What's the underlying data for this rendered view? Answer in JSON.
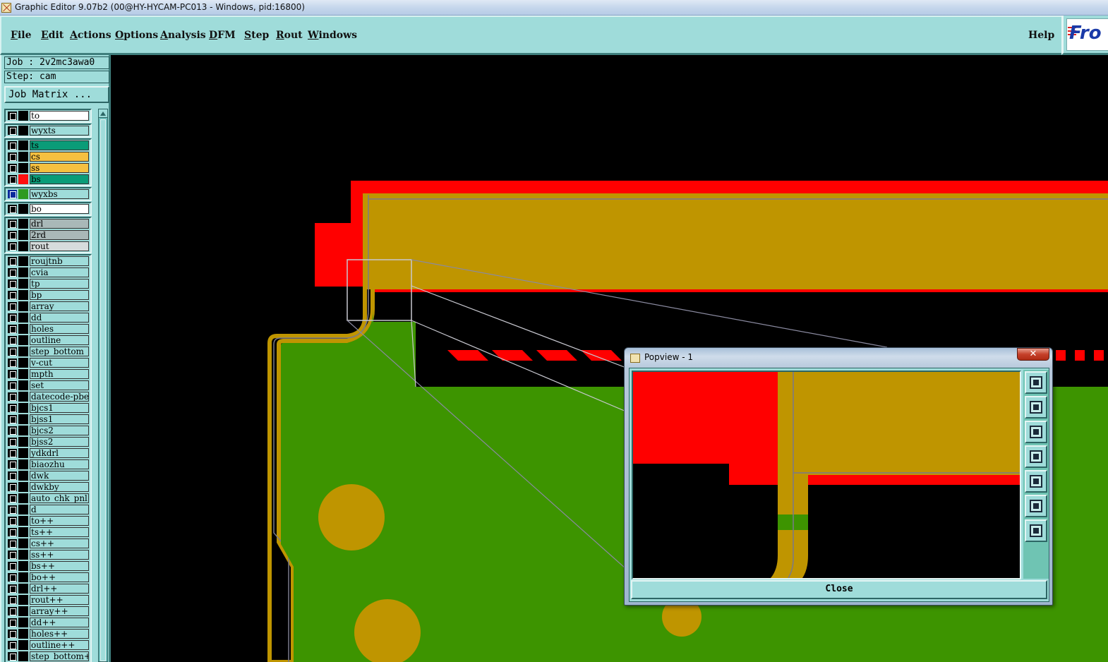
{
  "titlebar": {
    "title": "Graphic Editor 9.07b2 (00@HY-HYCAM-PC013 - Windows, pid:16800)"
  },
  "menu": {
    "items": [
      {
        "ul": "F",
        "rest": "ile"
      },
      {
        "ul": "E",
        "rest": "dit"
      },
      {
        "ul": "A",
        "rest": "ctions"
      },
      {
        "ul": "O",
        "rest": "ptions"
      },
      {
        "ul": "A",
        "rest": "nalysis"
      },
      {
        "ul": "D",
        "rest": "FM"
      },
      {
        "ul": "S",
        "rest": "tep"
      },
      {
        "ul": "R",
        "rest": "out"
      },
      {
        "ul": "W",
        "rest": "indows"
      }
    ],
    "help": "Help",
    "logo_text": "Fro"
  },
  "job": {
    "job_label": "Job : 2v2mc3awa0",
    "step_label": "Step: cam",
    "matrix_button": "Job Matrix ..."
  },
  "layers": [
    {
      "name": "to",
      "bg": "#ffffff",
      "swatch": "#000000"
    },
    {
      "name": "wyxts",
      "bg": "#9fdcda",
      "swatch": "#000000"
    },
    {
      "name": "ts",
      "bg": "#0a9c78",
      "swatch": "#000000"
    },
    {
      "name": "cs",
      "bg": "#f5c040",
      "swatch": "#000000"
    },
    {
      "name": "ss",
      "bg": "#f5c040",
      "swatch": "#000000"
    },
    {
      "name": "bs",
      "bg": "#0a9c78",
      "swatch": "#ff1010"
    },
    {
      "name": "wyxbs",
      "bg": "#9fdcda",
      "swatch": "#2e9a20"
    },
    {
      "name": "bo",
      "bg": "#ffffff",
      "swatch": "#000000"
    },
    {
      "name": "drl",
      "bg": "#a9b8b8",
      "swatch": "#000000"
    },
    {
      "name": "2rd",
      "bg": "#a9b8b8",
      "swatch": "#000000"
    },
    {
      "name": "rout",
      "bg": "#d6dcdc",
      "swatch": "#000000"
    },
    {
      "name": "roujtnb",
      "bg": "#9fdcda",
      "swatch": "#000000"
    },
    {
      "name": "cvia",
      "bg": "#9fdcda",
      "swatch": "#000000"
    },
    {
      "name": "tp",
      "bg": "#9fdcda",
      "swatch": "#000000"
    },
    {
      "name": "bp",
      "bg": "#9fdcda",
      "swatch": "#000000"
    },
    {
      "name": "array",
      "bg": "#9fdcda",
      "swatch": "#000000"
    },
    {
      "name": "dd",
      "bg": "#9fdcda",
      "swatch": "#000000"
    },
    {
      "name": "holes",
      "bg": "#9fdcda",
      "swatch": "#000000"
    },
    {
      "name": "outline",
      "bg": "#9fdcda",
      "swatch": "#000000"
    },
    {
      "name": "step_bottom",
      "bg": "#9fdcda",
      "swatch": "#000000"
    },
    {
      "name": "v-cut",
      "bg": "#9fdcda",
      "swatch": "#000000"
    },
    {
      "name": "mpth",
      "bg": "#9fdcda",
      "swatch": "#000000"
    },
    {
      "name": "set",
      "bg": "#9fdcda",
      "swatch": "#000000"
    },
    {
      "name": "datecode-pbe",
      "bg": "#9fdcda",
      "swatch": "#000000"
    },
    {
      "name": "bjcs1",
      "bg": "#9fdcda",
      "swatch": "#000000"
    },
    {
      "name": "bjss1",
      "bg": "#9fdcda",
      "swatch": "#000000"
    },
    {
      "name": "bjcs2",
      "bg": "#9fdcda",
      "swatch": "#000000"
    },
    {
      "name": "bjss2",
      "bg": "#9fdcda",
      "swatch": "#000000"
    },
    {
      "name": "ydkdrl",
      "bg": "#9fdcda",
      "swatch": "#000000"
    },
    {
      "name": "biaozhu",
      "bg": "#9fdcda",
      "swatch": "#000000"
    },
    {
      "name": "dwk",
      "bg": "#9fdcda",
      "swatch": "#000000"
    },
    {
      "name": "dwkby",
      "bg": "#9fdcda",
      "swatch": "#000000"
    },
    {
      "name": "auto_chk_pnl",
      "bg": "#9fdcda",
      "swatch": "#000000"
    },
    {
      "name": "d",
      "bg": "#9fdcda",
      "swatch": "#000000"
    },
    {
      "name": "to++",
      "bg": "#9fdcda",
      "swatch": "#000000"
    },
    {
      "name": "ts++",
      "bg": "#9fdcda",
      "swatch": "#000000"
    },
    {
      "name": "cs++",
      "bg": "#9fdcda",
      "swatch": "#000000"
    },
    {
      "name": "ss++",
      "bg": "#9fdcda",
      "swatch": "#000000"
    },
    {
      "name": "bs++",
      "bg": "#9fdcda",
      "swatch": "#000000"
    },
    {
      "name": "bo++",
      "bg": "#9fdcda",
      "swatch": "#000000"
    },
    {
      "name": "drl++",
      "bg": "#9fdcda",
      "swatch": "#000000"
    },
    {
      "name": "rout++",
      "bg": "#9fdcda",
      "swatch": "#000000"
    },
    {
      "name": "array++",
      "bg": "#9fdcda",
      "swatch": "#000000"
    },
    {
      "name": "dd++",
      "bg": "#9fdcda",
      "swatch": "#000000"
    },
    {
      "name": "holes++",
      "bg": "#9fdcda",
      "swatch": "#000000"
    },
    {
      "name": "outline++",
      "bg": "#9fdcda",
      "swatch": "#000000"
    },
    {
      "name": "step_bottom+",
      "bg": "#9fdcda",
      "swatch": "#000000"
    }
  ],
  "popview": {
    "title": "Popview - 1",
    "close_x": "✕",
    "close_button": "Close",
    "tools": [
      "zoom-home-icon",
      "pan-up-icon",
      "pan-down-icon",
      "pan-left-icon",
      "pan-right-icon",
      "zoom-out-icon",
      "zoom-in-icon"
    ]
  },
  "colors": {
    "ui_bg": "#9fdcda",
    "board_green": "#3d9400",
    "copper_gold": "#bf9500",
    "mask_red": "#ff0000"
  }
}
